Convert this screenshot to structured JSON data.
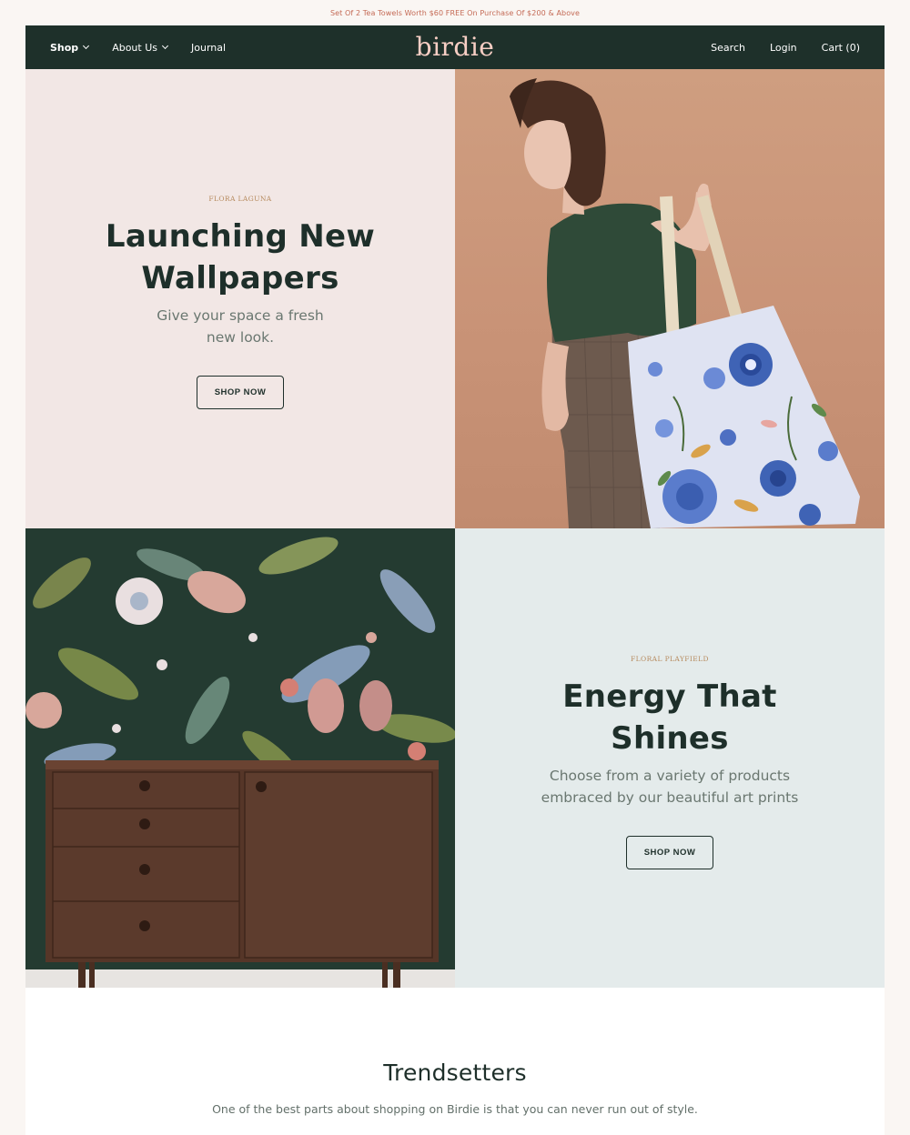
{
  "announcement": "Set Of 2 Tea Towels Worth $60 FREE On Purchase Of $200 & Above",
  "nav": {
    "left": [
      {
        "label": "Shop",
        "dropdown": true,
        "active": true
      },
      {
        "label": "About Us",
        "dropdown": true,
        "active": false
      },
      {
        "label": "Journal",
        "dropdown": false,
        "active": false
      }
    ],
    "logo": "birdie",
    "search": "Search",
    "login": "Login",
    "cart": "Cart (0)"
  },
  "hero1": {
    "eyebrow": "FLORA LAGUNA",
    "headline_line1": "Launching New",
    "headline_line2": "Wallpapers",
    "sub_line1": "Give your space a fresh",
    "sub_line2": "new look.",
    "cta": "SHOP NOW"
  },
  "hero2": {
    "eyebrow": "FLORAL PLAYFIELD",
    "headline_line1": "Energy That",
    "headline_line2": "Shines",
    "sub_line1": "Choose from a variety of products",
    "sub_line2": "embraced by our beautiful art prints",
    "cta": "SHOP NOW"
  },
  "trendsetters": {
    "title": "Trendsetters",
    "text": "One of the best parts about shopping on Birdie is that you can never run out of style."
  },
  "colors": {
    "nav_bg": "#1e302a",
    "logo": "#f7cec4",
    "announcement": "#c46a55",
    "tile_pink": "#f2e7e5",
    "tile_mint": "#e4ebeb",
    "eyebrow": "#b68a5e"
  }
}
